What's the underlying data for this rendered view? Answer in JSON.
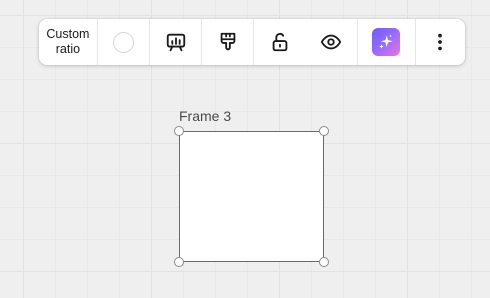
{
  "toolbar": {
    "ratio_line1": "Custom",
    "ratio_line2": "ratio",
    "fill_color": "#ffffff",
    "icons": [
      "presentation-icon",
      "paint-brush-icon",
      "unlock-icon",
      "eye-icon",
      "ai-sparkle-icon",
      "more-vertical-icon"
    ],
    "accent_gradient": [
      "#6a5cff",
      "#ef73d6"
    ]
  },
  "frame": {
    "label": "Frame 3",
    "border_color": "#4262ff"
  }
}
